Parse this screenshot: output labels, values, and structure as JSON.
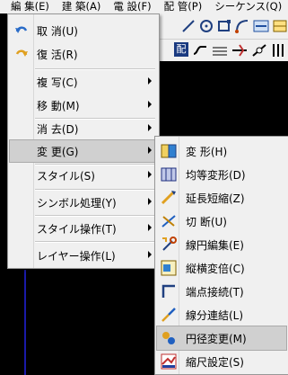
{
  "menubar": {
    "items": [
      "編 集(E)",
      "建 築(A)",
      "電 設(F)",
      "配 管(P)",
      "シーケンス(Q)"
    ]
  },
  "edit_menu": {
    "items": [
      {
        "label": "取 消(U)",
        "icon": "undo-icon",
        "submenu": false
      },
      {
        "label": "復 活(R)",
        "icon": "redo-icon",
        "submenu": false
      },
      {
        "label": "複 写(C)",
        "submenu": true
      },
      {
        "label": "移 動(M)",
        "submenu": true
      },
      {
        "label": "消 去(D)",
        "submenu": true
      },
      {
        "label": "変 更(G)",
        "submenu": true,
        "highlighted": true
      },
      {
        "label": "スタイル(S)",
        "submenu": true
      },
      {
        "label": "シンボル処理(Y)",
        "submenu": true
      },
      {
        "label": "スタイル操作(T)",
        "submenu": true
      },
      {
        "label": "レイヤー操作(L)",
        "submenu": true
      }
    ]
  },
  "change_submenu": {
    "items": [
      {
        "label": "変 形(H)",
        "icon": "transform-icon"
      },
      {
        "label": "均等変形(D)",
        "icon": "uniform-transform-icon"
      },
      {
        "label": "延長短縮(Z)",
        "icon": "extend-shorten-icon"
      },
      {
        "label": "切 断(U)",
        "icon": "cut-icon"
      },
      {
        "label": "線円編集(E)",
        "icon": "line-circle-edit-icon"
      },
      {
        "label": "縦横変倍(C)",
        "icon": "scale-xy-icon"
      },
      {
        "label": "端点接続(T)",
        "icon": "endpoint-connect-icon"
      },
      {
        "label": "線分連結(L)",
        "icon": "segment-join-icon"
      },
      {
        "label": "円径変更(M)",
        "icon": "circle-diameter-icon",
        "highlighted": true
      },
      {
        "label": "縮尺設定(S)",
        "icon": "scale-setting-icon"
      }
    ]
  },
  "toolbar": {
    "badge_label": "配"
  }
}
